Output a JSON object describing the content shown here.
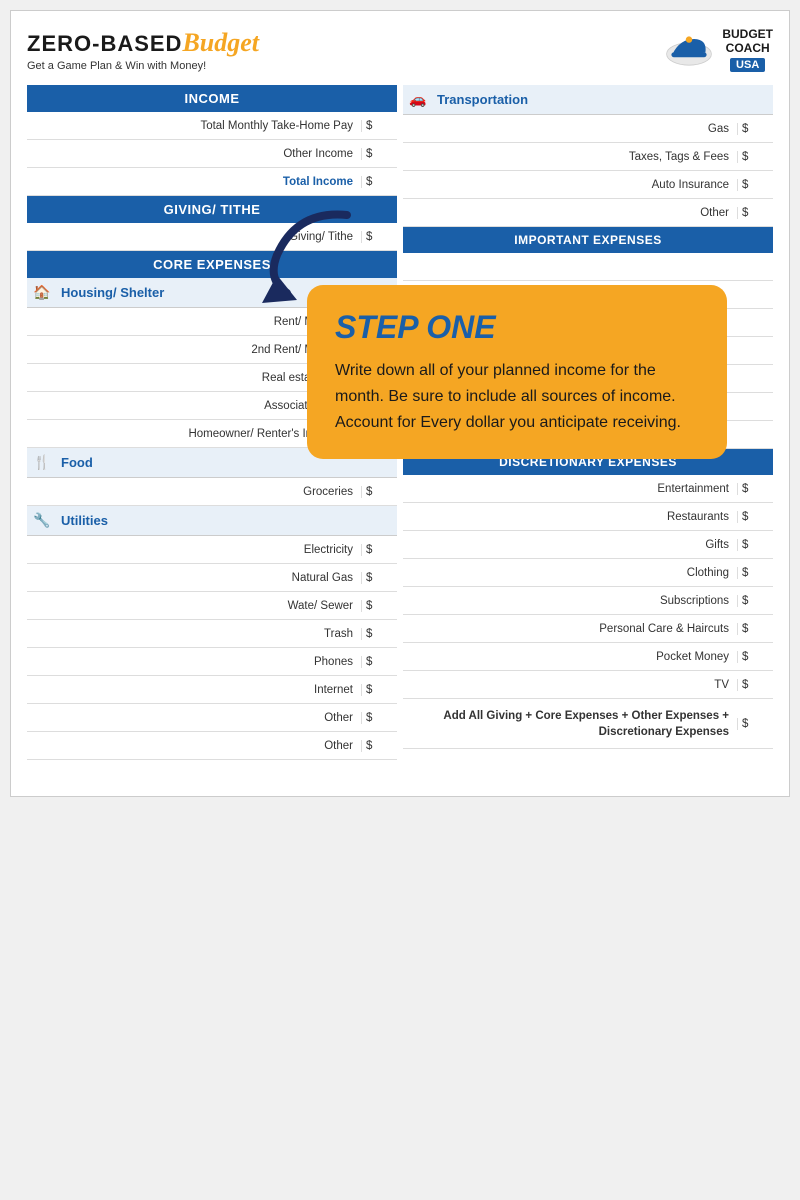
{
  "header": {
    "title_zero": "ZERO-BASED",
    "title_budget": "Budget",
    "subtitle": "Get a Game Plan & Win with Money!",
    "brand_budget": "BUDGET",
    "brand_coach": "COACH",
    "brand_usa": "USA"
  },
  "left": {
    "income_header": "INCOME",
    "rows_income": [
      {
        "label": "Total Monthly Take-Home Pay",
        "dollar": "$"
      },
      {
        "label": "Other Income",
        "dollar": "$"
      },
      {
        "label": "Total Income",
        "dollar": "$",
        "bold": true
      }
    ],
    "giving_header": "GIVING/ TITHE",
    "rows_giving": [
      {
        "label": "Giving/ Tithe",
        "dollar": "$"
      }
    ],
    "core_header": "CORE EXPENSES",
    "housing_cat": "Housing/ Shelter",
    "rows_housing": [
      {
        "label": "Rent/ Mortgage",
        "dollar": "$"
      },
      {
        "label": "2nd Rent/ Mortgage",
        "dollar": "$"
      },
      {
        "label": "Real estate Taxes",
        "dollar": "$"
      },
      {
        "label": "Association Dues",
        "dollar": "$"
      },
      {
        "label": "Homeowner/ Renter's Insurance",
        "dollar": "$"
      }
    ],
    "food_cat": "Food",
    "rows_food": [
      {
        "label": "Groceries",
        "dollar": "$"
      }
    ],
    "utilities_cat": "Utilities",
    "rows_utilities": [
      {
        "label": "Electricity",
        "dollar": "$"
      },
      {
        "label": "Natural Gas",
        "dollar": "$"
      },
      {
        "label": "Wate/ Sewer",
        "dollar": "$"
      },
      {
        "label": "Trash",
        "dollar": "$"
      },
      {
        "label": "Phones",
        "dollar": "$"
      },
      {
        "label": "Internet",
        "dollar": "$"
      },
      {
        "label": "Other",
        "dollar": "$"
      },
      {
        "label": "Other",
        "dollar": "$"
      }
    ]
  },
  "right": {
    "transport_header": "Transportation",
    "rows_transport": [
      {
        "label": "Gas",
        "dollar": "$"
      },
      {
        "label": "Taxes, Tags & Fees",
        "dollar": "$"
      },
      {
        "label": "Auto Insurance",
        "dollar": "$"
      },
      {
        "label": "Other",
        "dollar": "$"
      }
    ],
    "important_header": "IMPORTANT EXPENSES",
    "discretionary_header": "DISCRETIONARY EXPENSES",
    "rows_discretionary": [
      {
        "label": "Entertainment",
        "dollar": "$"
      },
      {
        "label": "Restaurants",
        "dollar": "$"
      },
      {
        "label": "Gifts",
        "dollar": "$"
      },
      {
        "label": "Clothing",
        "dollar": "$"
      },
      {
        "label": "Subscriptions",
        "dollar": "$"
      },
      {
        "label": "Personal Care & Haircuts",
        "dollar": "$"
      },
      {
        "label": "Pocket Money",
        "dollar": "$"
      },
      {
        "label": "TV",
        "dollar": "$"
      }
    ],
    "summary_label": "Add All Giving + Core Expenses + Other Expenses + Discretionary Expenses",
    "summary_dollar": "$"
  },
  "step": {
    "title": "STEP ONE",
    "body": "Write down all of your planned income for the month.  Be sure to include all sources of income. Account for Every dollar you anticipate receiving."
  }
}
